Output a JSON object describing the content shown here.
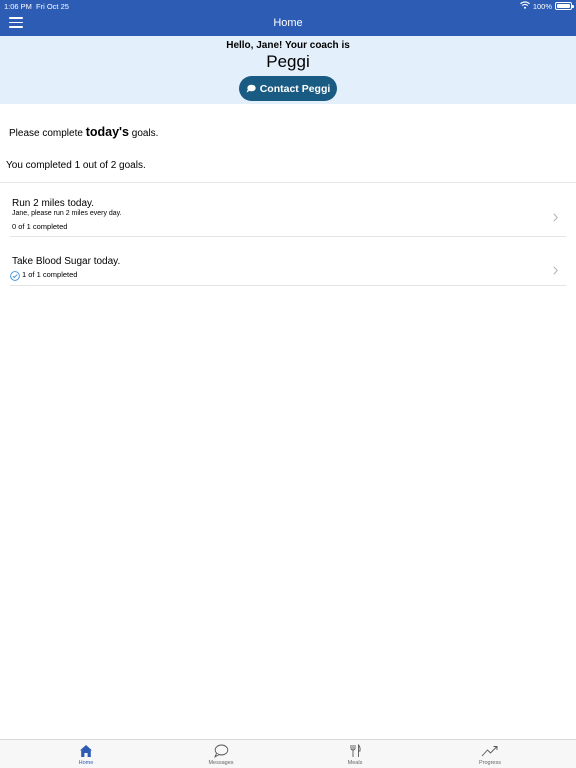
{
  "status_bar": {
    "time": "1:06 PM",
    "date": "Fri Oct 25",
    "battery": "100%"
  },
  "nav": {
    "title": "Home",
    "menu_icon": "hamburger-menu-icon"
  },
  "coach": {
    "greeting": "Hello, Jane! Your coach is",
    "name": "Peggi",
    "contact_label": "Contact Peggi",
    "contact_icon": "chat-bubble-icon"
  },
  "instruction": {
    "prefix": "Please complete ",
    "emphasis": "today's",
    "suffix": " goals."
  },
  "summary": "You completed 1 out of 2 goals.",
  "goals": [
    {
      "title": "Run 2 miles today.",
      "description": "Jane, please run 2 miles every day.",
      "progress": "0 of 1 completed",
      "completed": false
    },
    {
      "title": "Take Blood Sugar today.",
      "description": "",
      "progress": "1 of 1 completed",
      "completed": true
    }
  ],
  "tabs": [
    {
      "label": "Home",
      "icon": "home-icon",
      "active": true
    },
    {
      "label": "Messages",
      "icon": "chat-bubble-icon",
      "active": false
    },
    {
      "label": "Meals",
      "icon": "fork-knife-icon",
      "active": false
    },
    {
      "label": "Progress",
      "icon": "trend-up-icon",
      "active": false
    }
  ],
  "colors": {
    "header": "#2d5cb5",
    "coach_panel": "#e3f0fb",
    "contact_button": "#1a5b83",
    "check": "#3a8fd9"
  }
}
